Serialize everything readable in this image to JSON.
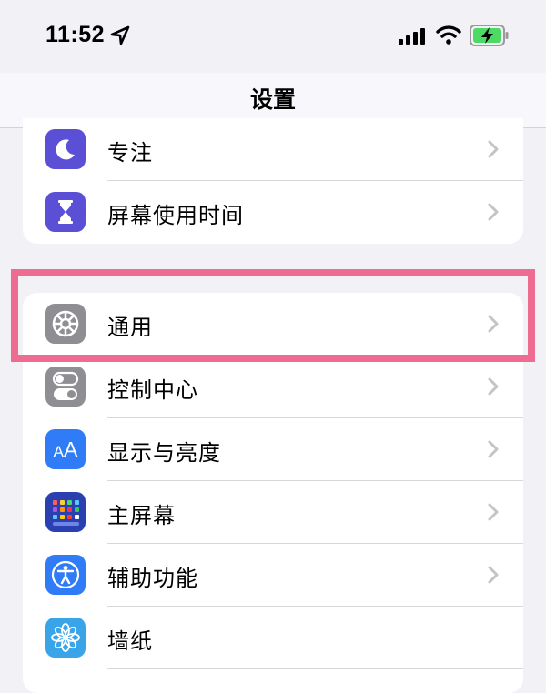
{
  "status_bar": {
    "time": "11:52",
    "icons": [
      "location-arrow-icon",
      "cellular-signal-icon",
      "wifi-icon",
      "battery-charging-icon"
    ]
  },
  "nav": {
    "title": "设置"
  },
  "groups": [
    {
      "items": [
        {
          "label": "专注",
          "icon": "moon-icon",
          "icon_color": "#5b4fd6"
        },
        {
          "label": "屏幕使用时间",
          "icon": "hourglass-icon",
          "icon_color": "#5b4fd6"
        }
      ]
    },
    {
      "items": [
        {
          "label": "通用",
          "icon": "gear-icon",
          "icon_color": "#8e8e93",
          "highlighted": true
        },
        {
          "label": "控制中心",
          "icon": "toggle-switches-icon",
          "icon_color": "#8e8e93"
        },
        {
          "label": "显示与亮度",
          "icon": "text-size-aa-icon",
          "icon_color": "#2f7cf6"
        },
        {
          "label": "主屏幕",
          "icon": "home-screen-grid-icon",
          "icon_color": "#2a3fb0"
        },
        {
          "label": "辅助功能",
          "icon": "accessibility-icon",
          "icon_color": "#2f7cf6"
        },
        {
          "label": "墙纸",
          "icon": "flower-icon",
          "icon_color": "#3aa4e8"
        }
      ]
    }
  ],
  "colors": {
    "background": "#f2f1f6",
    "highlight_border": "#ee6b92",
    "battery_green": "#4cd964"
  }
}
